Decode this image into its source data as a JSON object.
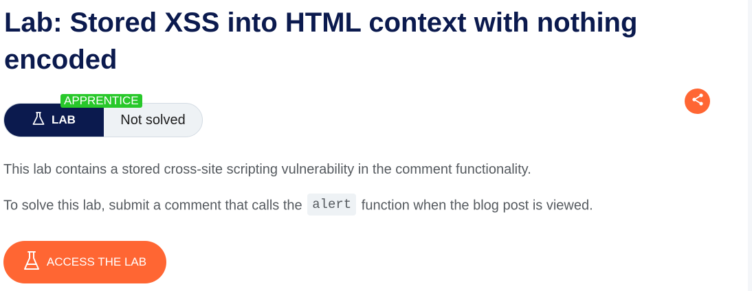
{
  "lab": {
    "title": "Lab: Stored XSS into HTML context with nothing encoded",
    "level_badge": "APPRENTICE",
    "type_label": "LAB",
    "status": "Not solved"
  },
  "description": {
    "line1": "This lab contains a stored cross-site scripting vulnerability in the comment functionality.",
    "line2_before": "To solve this lab, submit a comment that calls the",
    "line2_code": "alert",
    "line2_after": "function when the blog post is viewed."
  },
  "actions": {
    "access_label": "ACCESS THE LAB",
    "share_icon": "share-icon"
  },
  "colors": {
    "navy": "#0b1a4e",
    "orange": "#ff6633",
    "green": "#28c82a"
  }
}
